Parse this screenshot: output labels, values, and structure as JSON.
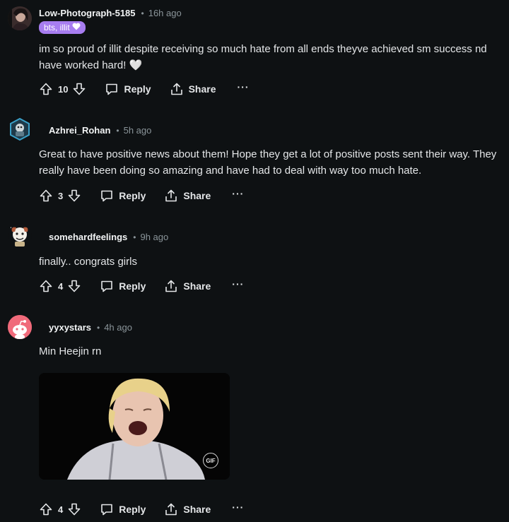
{
  "comments": [
    {
      "username": "Low-Photograph-5185",
      "time": "16h ago",
      "flair": "bts, illit",
      "text": "im so proud of illit despite receiving so much hate from all ends theyve achieved sm success nd have worked hard! 🤍",
      "votes": "10",
      "reply": "Reply",
      "share": "Share",
      "more": "···"
    },
    {
      "username": "Azhrei_Rohan",
      "time": "5h ago",
      "text": "Great to have positive news about them! Hope they get a lot of positive posts sent their way. They really have been doing so amazing and have had to deal with way too much hate.",
      "votes": "3",
      "reply": "Reply",
      "share": "Share",
      "more": "···"
    },
    {
      "username": "somehardfeelings",
      "time": "9h ago",
      "text": "finally.. congrats girls",
      "votes": "4",
      "reply": "Reply",
      "share": "Share",
      "more": "···"
    },
    {
      "username": "yyxystars",
      "time": "4h ago",
      "text": "Min Heejin rn",
      "gif_badge": "GIF",
      "votes": "4",
      "reply": "Reply",
      "share": "Share",
      "more": "···"
    }
  ],
  "separator": "•",
  "colors": {
    "background": "#0e1113",
    "flair": "#a77df0",
    "muted": "#8a9499"
  }
}
